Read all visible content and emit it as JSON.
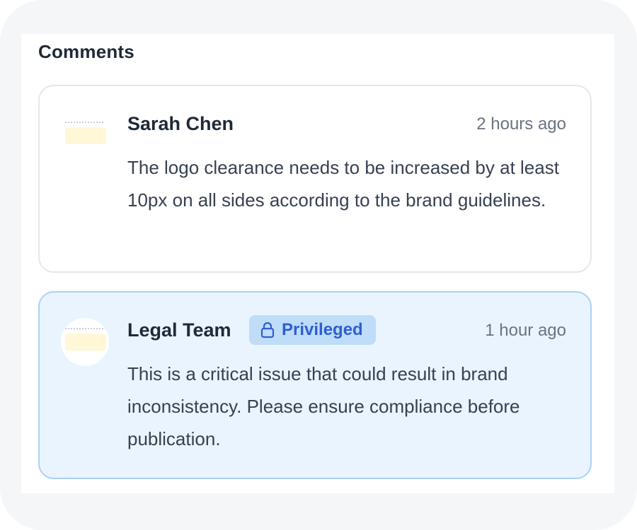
{
  "section": {
    "title": "Comments"
  },
  "comments": [
    {
      "author": "Sarah Chen",
      "time": "2 hours ago",
      "text": "The logo clearance needs to be increased by at least 10px on all sides according to the brand guidelines."
    },
    {
      "author": "Legal Team",
      "badge": "Privileged",
      "badge_icon": "lock-icon",
      "time": "1 hour ago",
      "text": "This is a critical issue that could result in brand inconsistency. Please ensure compliance before publication."
    }
  ],
  "colors": {
    "privileged_bg": "#eaf4fe",
    "privileged_border": "#a9d2f5",
    "badge_bg": "#bfdcf9",
    "badge_text": "#2f5fd0"
  }
}
